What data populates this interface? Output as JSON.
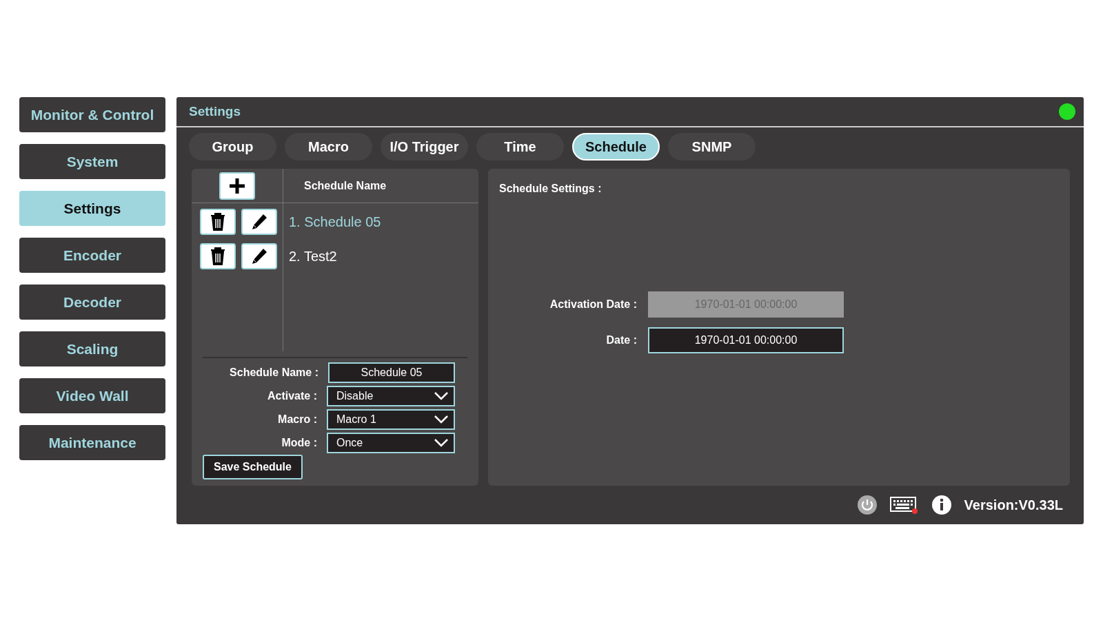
{
  "sidebar": {
    "items": [
      {
        "label": "Monitor & Control",
        "selected": false
      },
      {
        "label": "System",
        "selected": false
      },
      {
        "label": "Settings",
        "selected": true
      },
      {
        "label": "Encoder",
        "selected": false
      },
      {
        "label": "Decoder",
        "selected": false
      },
      {
        "label": "Scaling",
        "selected": false
      },
      {
        "label": "Video Wall",
        "selected": false
      },
      {
        "label": "Maintenance",
        "selected": false
      }
    ]
  },
  "panel": {
    "title": "Settings",
    "online": true
  },
  "tabs": [
    {
      "label": "Group",
      "selected": false
    },
    {
      "label": "Macro",
      "selected": false
    },
    {
      "label": "I/O Trigger",
      "selected": false
    },
    {
      "label": "Time",
      "selected": false
    },
    {
      "label": "Schedule",
      "selected": true
    },
    {
      "label": "SNMP",
      "selected": false
    }
  ],
  "schedule_list": {
    "column": "Schedule Name",
    "items": [
      {
        "name": "1. Schedule 05",
        "selected": true
      },
      {
        "name": "2. Test2",
        "selected": false
      }
    ]
  },
  "schedule_form": {
    "fields": [
      {
        "label": "Schedule Name :",
        "value": "Schedule 05",
        "kind": "text"
      },
      {
        "label": "Activate :",
        "value": "Disable",
        "kind": "select"
      },
      {
        "label": "Macro :",
        "value": "Macro 1",
        "kind": "select"
      },
      {
        "label": "Mode :",
        "value": "Once",
        "kind": "select"
      }
    ],
    "save_button": "Save Schedule"
  },
  "schedule_settings": {
    "title": "Schedule Settings :",
    "fields": [
      {
        "label": "Activation Date :",
        "value": "1970-01-01 00:00:00",
        "disabled": true
      },
      {
        "label": "Date :",
        "value": "1970-01-01 00:00:00",
        "disabled": false
      }
    ]
  },
  "footer": {
    "version": "Version:V0.33L"
  }
}
